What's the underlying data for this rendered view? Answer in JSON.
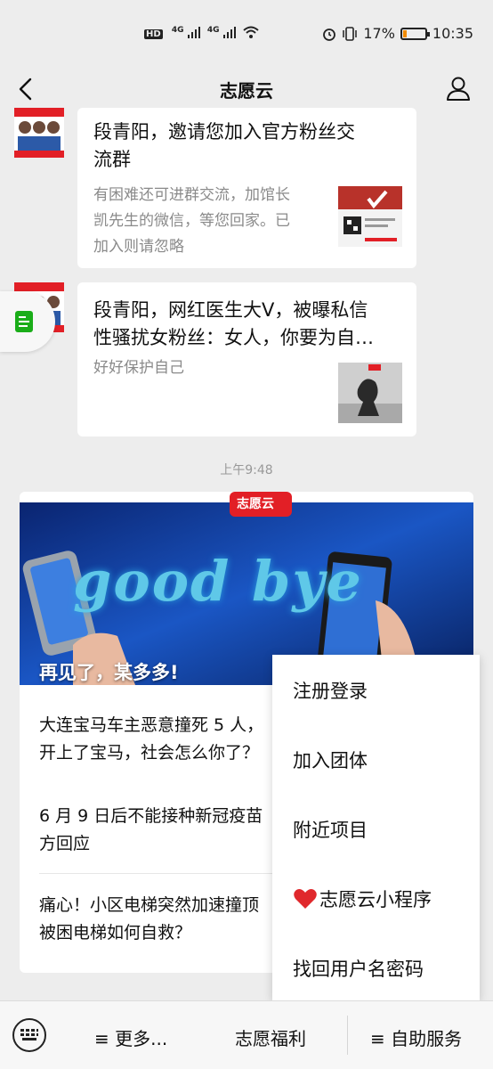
{
  "status_bar": {
    "network_label": "HD",
    "signal_label_1": "4G",
    "signal_label_2": "4G",
    "battery_percent": "17%",
    "battery_level": 0.17,
    "time": "10:35"
  },
  "header": {
    "title": "志愿云"
  },
  "messages": [
    {
      "title": "段青阳，邀请您加入官方粉丝交流群",
      "title_line1": "段青阳，邀请您加入官方粉丝交",
      "title_line2": "流群",
      "desc_line1": "有困难还可进群交流，加馆长",
      "desc_line2": "凯先生的微信，等您回家。已",
      "desc_line3": "加入则请忽略"
    },
    {
      "title_line1": "段青阳，网红医生大V，被曝私信",
      "title_line2": "性骚扰女粉丝：女人，你要为自…",
      "desc_line1": "好好保护自己"
    }
  ],
  "timestamp": "上午9:48",
  "article": {
    "brand_badge": "志愿云",
    "hero_text": "good bye",
    "hero_title": "再见了，某多多!",
    "items": [
      {
        "line1": "大连宝马车主恶意撞死 5 人，",
        "line2": "开上了宝马，社会怎么你了？"
      },
      {
        "line1": "6 月 9 日后不能接种新冠疫苗",
        "line2": "方回应"
      },
      {
        "line1": "痛心！小区电梯突然加速撞顶",
        "line2": "被困电梯如何自救？"
      }
    ]
  },
  "popup_menu": {
    "items": [
      "注册登录",
      "加入团体",
      "附近项目",
      "志愿云小程序",
      "找回用户名密码"
    ]
  },
  "bottom_bar": {
    "more_label": "≡ 更多...",
    "welfare_label": "志愿福利",
    "service_label": "≡ 自助服务"
  },
  "colors": {
    "background": "#ededed",
    "brand_red": "#e21f26",
    "battery_low": "#f08a00"
  }
}
